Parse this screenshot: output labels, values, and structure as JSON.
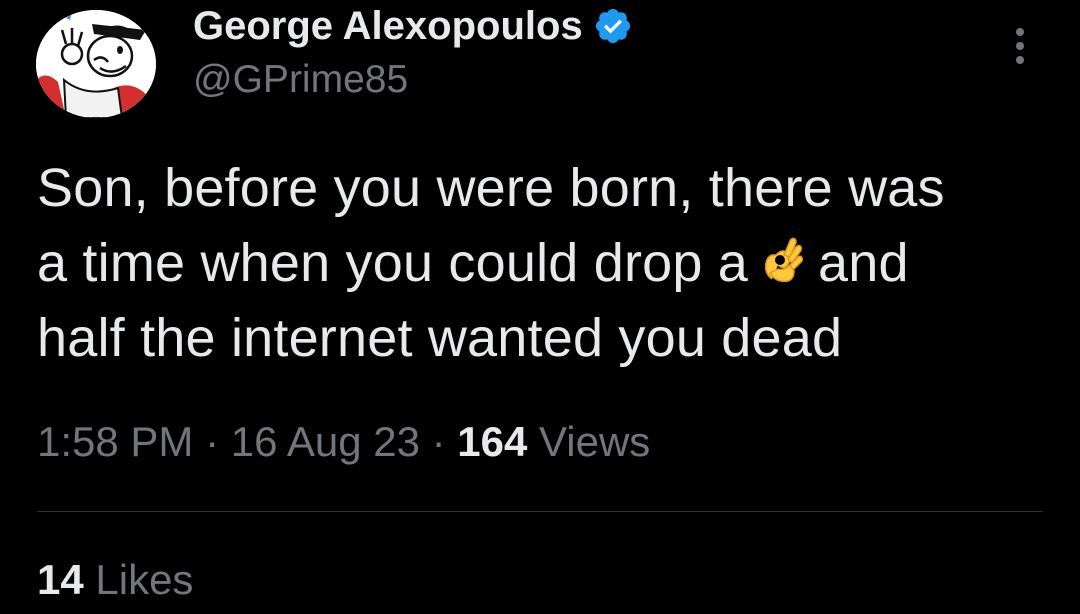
{
  "author": {
    "display_name": "George Alexopoulos",
    "handle": "@GPrime85",
    "verified_icon": "verified-badge-icon",
    "avatar_icon": "cartoon-chef-avatar"
  },
  "tweet": {
    "text_lines": [
      "Son, before you were born, there was",
      "a time when you could drop a",
      "and",
      "half the internet wanted you dead"
    ],
    "emoji": "ok-hand-emoji"
  },
  "meta": {
    "time": "1:58 PM",
    "separator1": " · ",
    "date": "16 Aug 23",
    "separator2": " · ",
    "views_count": "164",
    "views_label": " Views"
  },
  "stats": {
    "likes_count": "14",
    "likes_label": " Likes"
  },
  "colors": {
    "background": "#000000",
    "primary_text": "#e7e9ea",
    "secondary_text": "#71767b",
    "verified_blue": "#1d9bf0",
    "divider": "#2f3336"
  }
}
